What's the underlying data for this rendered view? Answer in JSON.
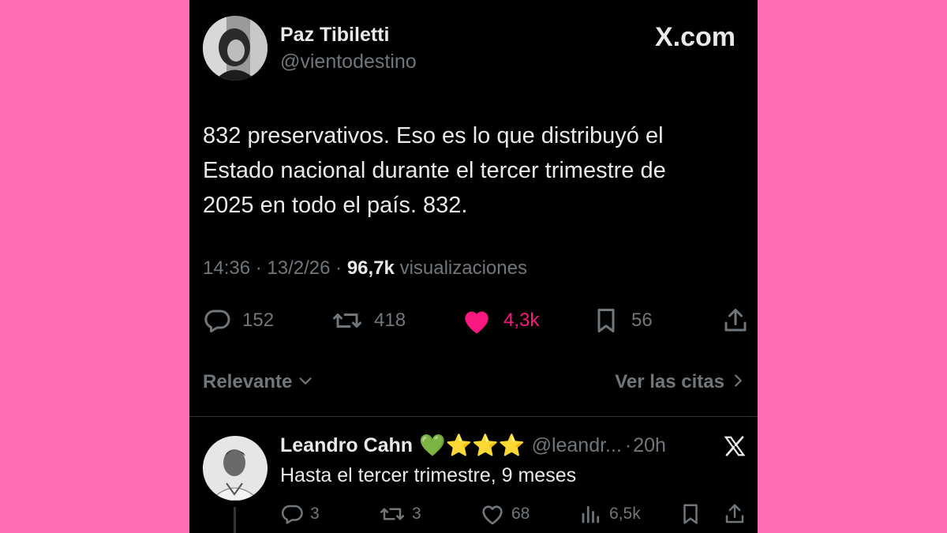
{
  "tweet": {
    "author_name": "Paz Tibiletti",
    "author_handle": "@vientodestino",
    "site_label": "X.com",
    "text_lines": [
      "832 preservativos.  Eso es lo que distribuyó el",
      "Estado nacional durante el tercer trimestre de",
      "2025 en todo el país. 832."
    ],
    "time": "14:36",
    "date": "13/2/26",
    "separator": "·",
    "views": "96,7k",
    "views_label": "visualizaciones",
    "replies": "152",
    "reposts": "418",
    "likes": "4,3k",
    "bookmarks": "56",
    "like_color": "#f91880"
  },
  "filters": {
    "sort_label": "Relevante",
    "quotes_label": "Ver las citas"
  },
  "reply": {
    "author_name": "Leandro Cahn",
    "emojis": "💚⭐⭐⭐",
    "author_handle": "@leandr...",
    "separator": "·",
    "age": "20h",
    "text": "Hasta el tercer trimestre, 9 meses",
    "replies": "3",
    "reposts": "3",
    "likes": "68",
    "views": "6,5k"
  }
}
